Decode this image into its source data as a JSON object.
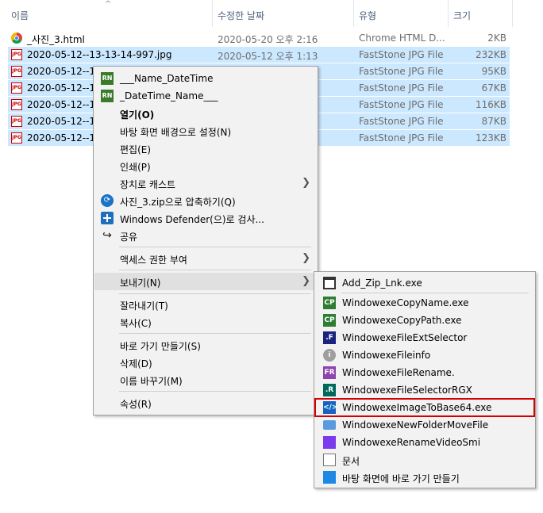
{
  "columns": {
    "name": "이름",
    "date": "수정한 날짜",
    "type": "유형",
    "size": "크기"
  },
  "files": [
    {
      "name": "_사진_3.html",
      "date": "2020-05-20 오후 2:16",
      "type": "Chrome HTML D...",
      "size": "2KB",
      "icon": "chrome-icon",
      "selected": false
    },
    {
      "name": "2020-05-12--13-13-14-997.jpg",
      "date": "2020-05-12 오후 1:13",
      "type": "FastStone JPG File",
      "size": "232KB",
      "icon": "jpg-icon",
      "selected": true
    },
    {
      "name": "2020-05-12--1",
      "date": "",
      "type": "FastStone JPG File",
      "size": "95KB",
      "icon": "jpg-icon",
      "selected": true
    },
    {
      "name": "2020-05-12--1",
      "date": "",
      "type": "FastStone JPG File",
      "size": "67KB",
      "icon": "jpg-icon",
      "selected": true
    },
    {
      "name": "2020-05-12--1",
      "date": "",
      "type": "FastStone JPG File",
      "size": "116KB",
      "icon": "jpg-icon",
      "selected": true
    },
    {
      "name": "2020-05-12--1",
      "date": "",
      "type": "FastStone JPG File",
      "size": "87KB",
      "icon": "jpg-icon",
      "selected": true
    },
    {
      "name": "2020-05-12--1",
      "date": "",
      "type": "FastStone JPG File",
      "size": "123KB",
      "icon": "jpg-icon",
      "selected": true
    }
  ],
  "context_menu": {
    "name_datetime": "___Name_DateTime",
    "datetime_name": "_DateTime_Name___",
    "open": "열기(O)",
    "set_wallpaper": "바탕 화면 배경으로 설정(N)",
    "edit": "편집(E)",
    "print": "인쇄(P)",
    "cast": "장치로 캐스트",
    "compress": "사진_3.zip으로 압축하기(Q)",
    "defender": "Windows Defender(으)로 검사...",
    "share": "공유",
    "give_access": "액세스 권한 부여",
    "send_to": "보내기(N)",
    "cut": "잘라내기(T)",
    "copy": "복사(C)",
    "create_shortcut": "바로 가기 만들기(S)",
    "delete": "삭제(D)",
    "rename": "이름 바꾸기(M)",
    "properties": "속성(R)",
    "rn_badge": "RN"
  },
  "send_to_menu": {
    "items": [
      {
        "label": "Add_Zip_Lnk.exe",
        "badge": "",
        "color": "#ffffff"
      },
      {
        "label": "WindowexeCopyName.exe",
        "badge": "CP",
        "color": "#2e7d32"
      },
      {
        "label": "WindowexeCopyPath.exe",
        "badge": "CP",
        "color": "#2e7d32"
      },
      {
        "label": "WindowexeFileExtSelector",
        "badge": ".F",
        "color": "#1a237e"
      },
      {
        "label": "WindowexeFileinfo",
        "badge": "i",
        "color": "#9e9e9e"
      },
      {
        "label": "WindowexeFileRename.",
        "badge": "FR",
        "color": "#8e44ad"
      },
      {
        "label": "WindowexeFileSelectorRGX",
        "badge": ".R",
        "color": "#00695c"
      },
      {
        "label": "WindowexeImageToBase64.exe",
        "badge": "</>",
        "color": "#1565c0"
      },
      {
        "label": "WindowexeNewFolderMoveFile",
        "badge": "",
        "color": "#5a9be0"
      },
      {
        "label": "WindowexeRenameVideoSmi",
        "badge": "",
        "color": "#7c3aed"
      },
      {
        "label": "문서",
        "badge": "",
        "color": "#777777"
      },
      {
        "label": "바탕 화면에 바로 가기 만들기",
        "badge": "",
        "color": "#1e88e5"
      }
    ]
  }
}
